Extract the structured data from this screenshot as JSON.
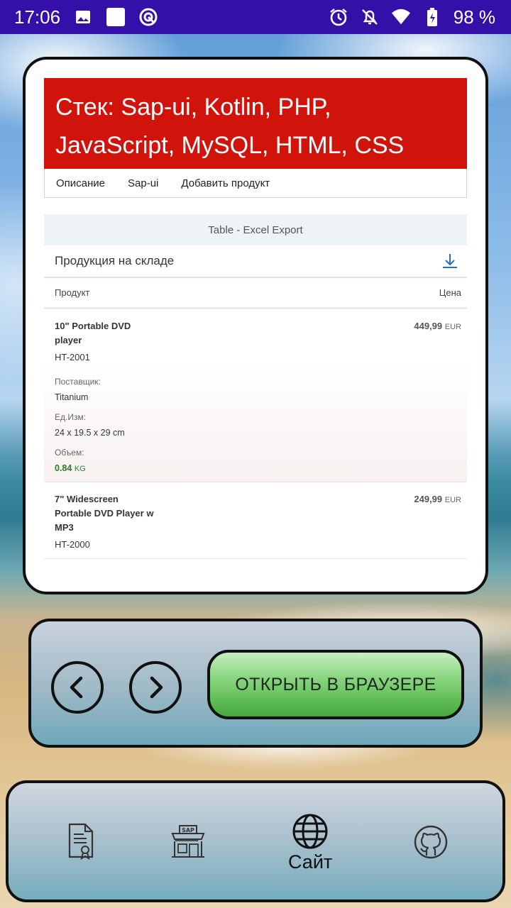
{
  "status_bar": {
    "time": "17:06",
    "battery": "98 %",
    "left_icons": [
      "image-icon",
      "square-icon",
      "sync-icon"
    ],
    "right_icons": [
      "alarm-icon",
      "notifications-off-icon",
      "wifi-icon",
      "battery-icon"
    ]
  },
  "web": {
    "header_title": "Стек: Sap-ui, Kotlin, PHP, JavaScript, MySQL, HTML, CSS",
    "tabs": [
      {
        "label": "Описание"
      },
      {
        "label": "Sap-ui"
      },
      {
        "label": "Добавить продукт"
      }
    ],
    "table_title": "Table - Excel Export",
    "toolbar_title": "Продукция на складе",
    "columns": {
      "product": "Продукт",
      "price": "Цена"
    },
    "rows": [
      {
        "name": "10\" Portable DVD player",
        "code": "HT-2001",
        "price": "449,99",
        "currency": "EUR",
        "supplier_label": "Поставщик:",
        "supplier": "Titanium",
        "dims_label": "Ед.Изм:",
        "dims": "24 x 19.5 x 29 cm",
        "weight_label": "Объем:",
        "weight": "0.84",
        "weight_unit": "KG"
      },
      {
        "name": "7\" Widescreen Portable DVD Player w MP3",
        "code": "HT-2000",
        "price": "249,99",
        "currency": "EUR"
      }
    ]
  },
  "controls": {
    "back_icon": "chevron-left-icon",
    "forward_icon": "chevron-right-icon",
    "open_browser_label": "ОТКРЫТЬ В БРАУЗЕРЕ"
  },
  "bottom_nav": {
    "items": [
      {
        "icon": "certificate-document-icon",
        "label": ""
      },
      {
        "icon": "sap-store-icon",
        "label": ""
      },
      {
        "icon": "globe-icon",
        "label": "Сайт"
      },
      {
        "icon": "github-icon",
        "label": ""
      }
    ]
  },
  "colors": {
    "status_bar": "#3510a8",
    "header_red": "#d0140c",
    "open_button_green": "#5fbd55",
    "weight_green": "#2b7c2b"
  }
}
